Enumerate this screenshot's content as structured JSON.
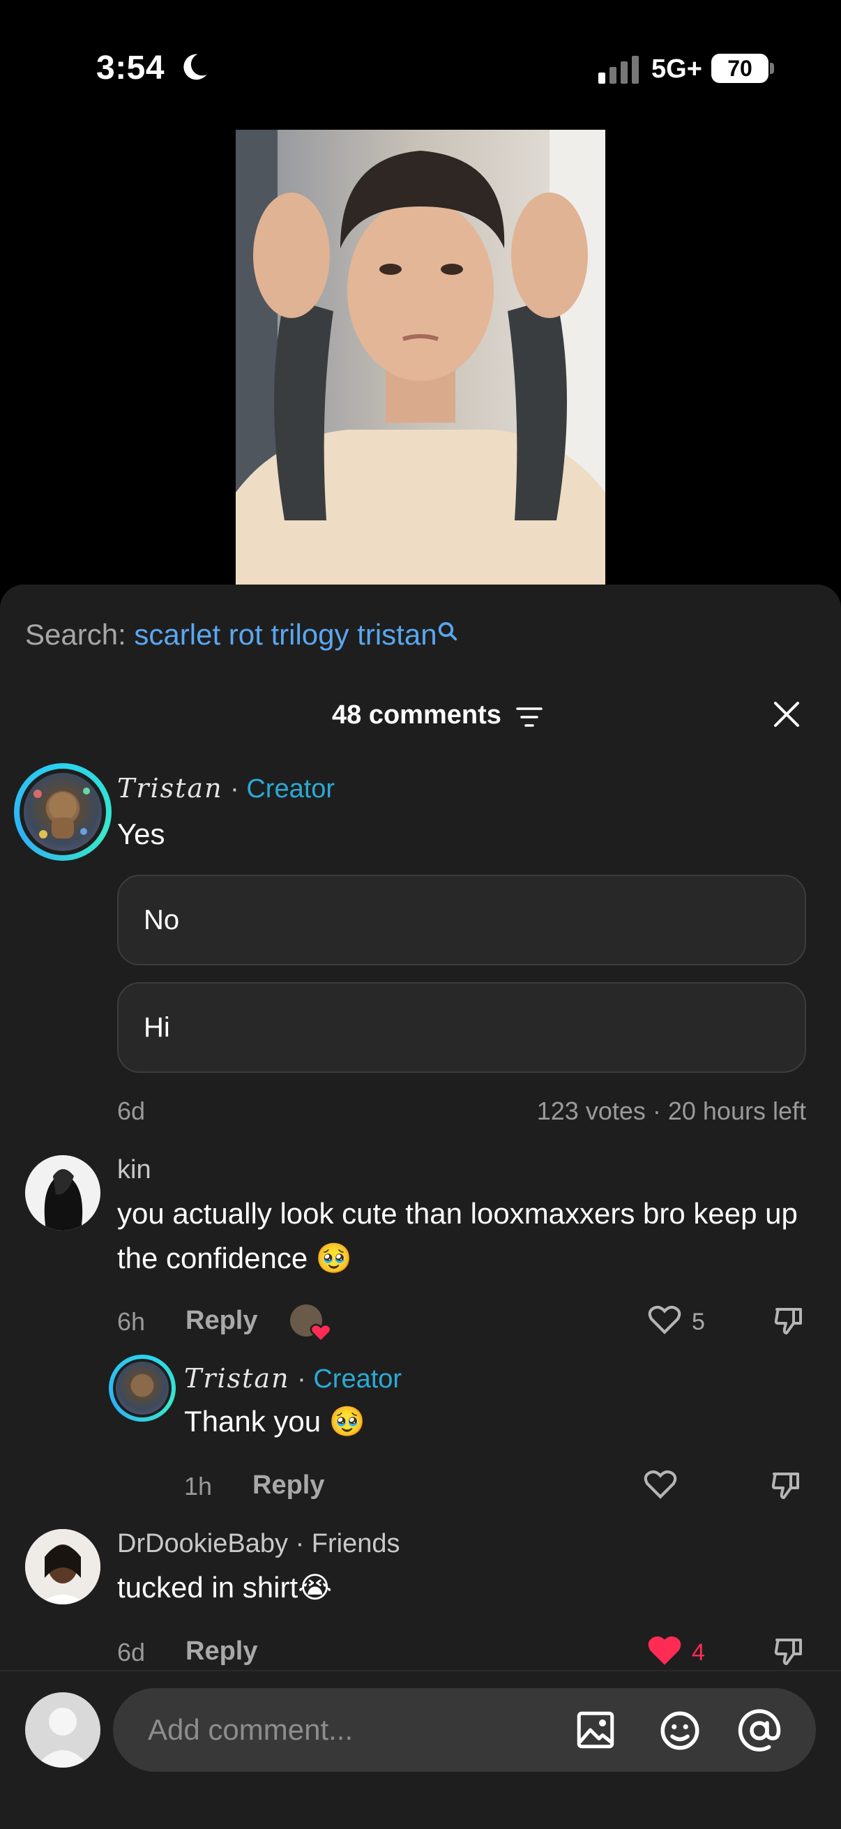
{
  "status_bar": {
    "time": "3:54",
    "network": "5G+",
    "battery": "70"
  },
  "search": {
    "label": "Search:",
    "query": "scarlet rot trilogy tristan"
  },
  "header": {
    "comments_count": "48 comments"
  },
  "comments": [
    {
      "author": "Tristan",
      "badge": "Creator",
      "text": "Yes",
      "poll_options": [
        "No",
        "Hi"
      ],
      "age": "6d",
      "poll_meta": "123 votes · 20 hours left"
    },
    {
      "author": "kin",
      "text": "you actually look cute than looxmaxxers bro keep up the confidence 🥹",
      "age": "6h",
      "reply_label": "Reply",
      "likes": "5",
      "replies": [
        {
          "author": "Tristan",
          "badge": "Creator",
          "text": "Thank you 🥹",
          "age": "1h",
          "reply_label": "Reply"
        }
      ]
    },
    {
      "author": "DrDookieBaby",
      "relation": "Friends",
      "text": "tucked in shirt😭",
      "age": "6d",
      "reply_label": "Reply",
      "likes": "4"
    }
  ],
  "composer": {
    "placeholder": "Add comment..."
  },
  "colors": {
    "accent_link": "#5aa7f0",
    "creator": "#2aaad6",
    "like_red": "#fe2c55",
    "sheet_bg": "#1e1e1e"
  },
  "icons": [
    "moon-icon",
    "signal-icon",
    "search-icon",
    "filter-icon",
    "close-icon",
    "heart-icon",
    "dislike-icon",
    "image-icon",
    "sticker-icon",
    "at-icon"
  ]
}
